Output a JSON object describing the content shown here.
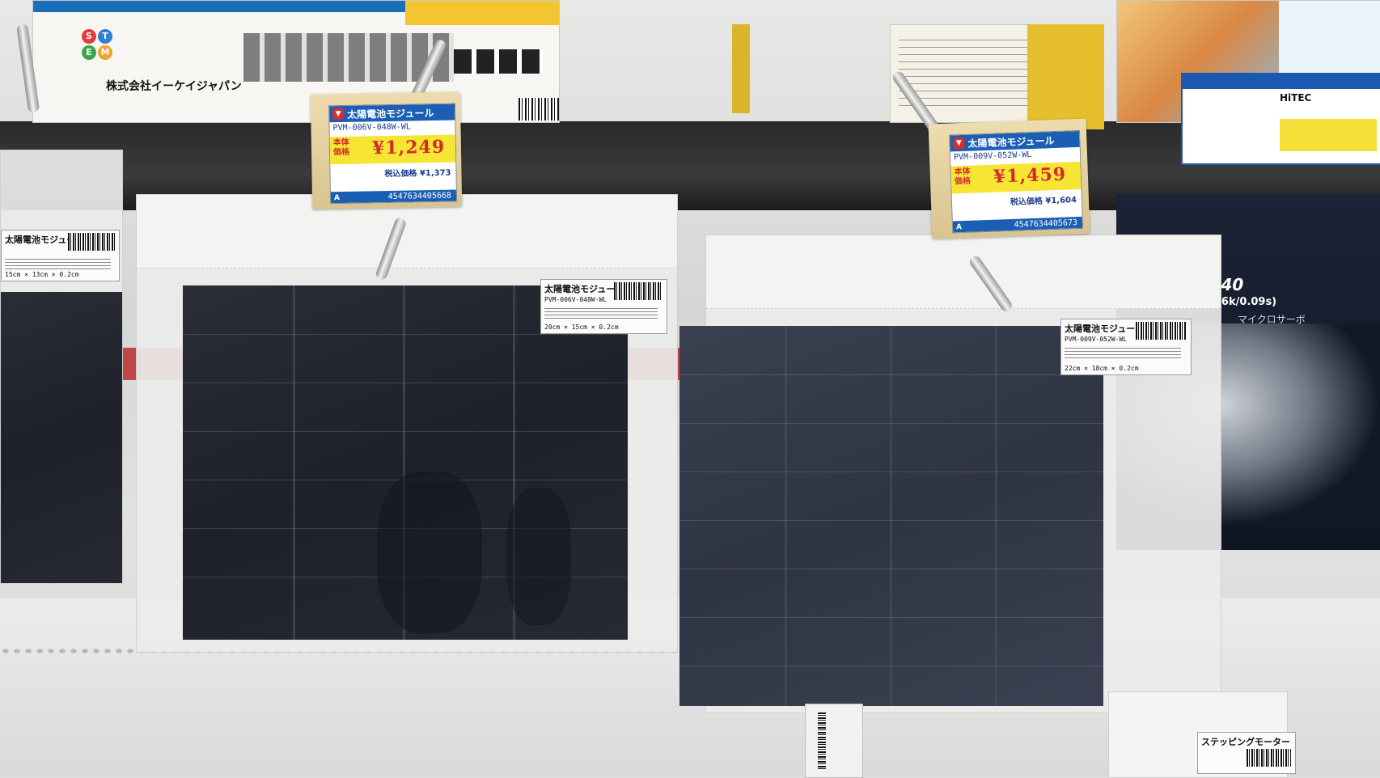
{
  "background_boxes": {
    "stem_company": "株式会社イーケイジャパン",
    "stem_letters": [
      "S",
      "T",
      "E",
      "M"
    ],
    "servo_title": "HS-40",
    "servo_spec": "(0.6k/0.09s)",
    "servo_sub": "マイクロサーボ",
    "servo_tag_label": "HiTEC"
  },
  "products": [
    {
      "sticker_name": "太陽電池モジュール",
      "sticker_code": "PVM-006V-048W-WL",
      "sticker_dims": "20cm × 15cm × 0.2cm",
      "tag": {
        "title": "太陽電池モジュール",
        "code": "PVM-006V-048W-WL",
        "hontai_label": "本体価格",
        "price": "¥1,249",
        "tax_label": "税込価格 ¥1,373",
        "jan": "4547634405668",
        "rank": "A"
      }
    },
    {
      "sticker_name": "太陽電池モジュール",
      "sticker_code": "PVM-009V-052W-WL",
      "sticker_dims": "22cm × 18cm × 0.2cm",
      "tag": {
        "title": "太陽電池モジュール",
        "code": "PVM-009V-052W-WL",
        "hontai_label": "本体価格",
        "price": "¥1,459",
        "tax_label": "税込価格 ¥1,604",
        "jan": "4547634405673",
        "rank": "A"
      }
    }
  ],
  "left_partial_sticker": {
    "name": "太陽電池モジュール",
    "dims": "15cm × 13cm × 0.2cm"
  },
  "bottom_item": {
    "name": "ステッピングモーター"
  }
}
